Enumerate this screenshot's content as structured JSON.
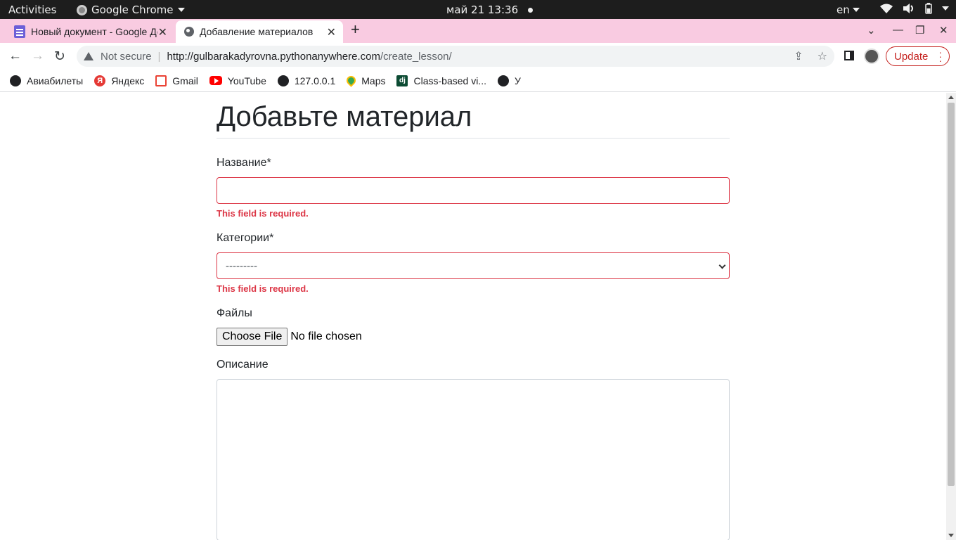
{
  "topbar": {
    "activities": "Activities",
    "app_name": "Google Chrome",
    "clock": "май 21  13:36",
    "lang": "en"
  },
  "tabs": [
    {
      "title": "Новый документ - Google Документы",
      "icon": "docs-icon",
      "active": false
    },
    {
      "title": "Добавление материалов",
      "icon": "globe-icon",
      "active": true
    }
  ],
  "toolbar": {
    "security_label": "Not secure",
    "url_host": "http://gulbarakadyrovna.pythonanywhere.com",
    "url_path": "/create_lesson/",
    "update_label": "Update"
  },
  "bookmarks": [
    {
      "label": "Авиабилеты",
      "icon": "globe-icon"
    },
    {
      "label": "Яндекс",
      "icon": "yandex-icon"
    },
    {
      "label": "Gmail",
      "icon": "gmail-icon"
    },
    {
      "label": "YouTube",
      "icon": "youtube-icon"
    },
    {
      "label": "127.0.0.1",
      "icon": "globe-icon"
    },
    {
      "label": "Maps",
      "icon": "maps-icon"
    },
    {
      "label": "Class-based vi...",
      "icon": "django-icon"
    },
    {
      "label": "У",
      "icon": "globe-icon"
    }
  ],
  "form": {
    "title": "Добавьте материал",
    "name_label": "Название*",
    "name_value": "",
    "name_error": "This field is required.",
    "category_label": "Категории*",
    "category_selected": "---------",
    "category_error": "This field is required.",
    "files_label": "Файлы",
    "file_button": "Choose File",
    "file_status": "No file chosen",
    "description_label": "Описание",
    "description_value": ""
  },
  "colors": {
    "tabstrip": "#f9cbe1",
    "error": "#dc3545",
    "update": "#c5221f"
  }
}
